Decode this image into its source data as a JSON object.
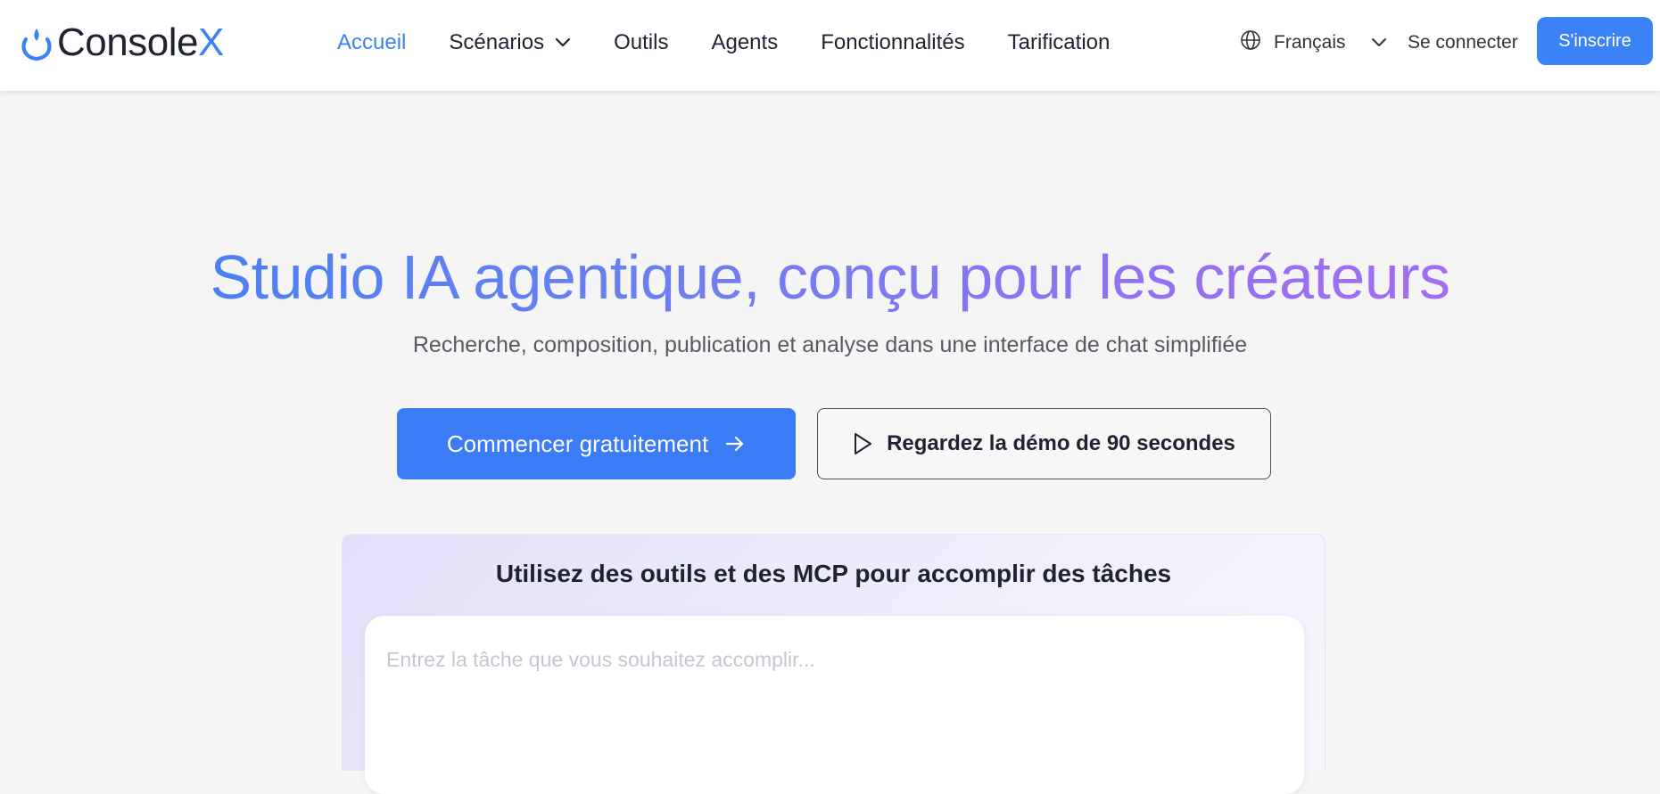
{
  "brand": {
    "name_main": "Console",
    "name_accent": "X",
    "accent_color": "#3b82f6"
  },
  "nav": {
    "items": [
      {
        "label": "Accueil",
        "active": true
      },
      {
        "label": "Scénarios",
        "has_dropdown": true
      },
      {
        "label": "Outils"
      },
      {
        "label": "Agents"
      },
      {
        "label": "Fonctionnalités"
      },
      {
        "label": "Tarification"
      }
    ]
  },
  "header_right": {
    "language": "Français",
    "login_label": "Se connecter",
    "signup_label": "S'inscrire"
  },
  "hero": {
    "title": "Studio IA agentique, conçu pour les créateurs",
    "subtitle": "Recherche, composition, publication et analyse dans une interface de chat simplifiée",
    "primary_cta": "Commencer gratuitement",
    "secondary_cta": "Regardez la démo de 90 secondes",
    "gradient_colors": [
      "#3b82f6",
      "#a86cf4"
    ]
  },
  "task": {
    "title": "Utilisez des outils et des MCP pour accomplir des tâches",
    "input_value": "",
    "input_placeholder": "Entrez la tâche que vous souhaitez accomplir..."
  },
  "icons": {
    "logo": "consolex-logo-icon",
    "language": "globe-icon",
    "dropdown": "chevron-down-icon",
    "cta_arrow": "arrow-right-icon",
    "play": "play-icon"
  }
}
